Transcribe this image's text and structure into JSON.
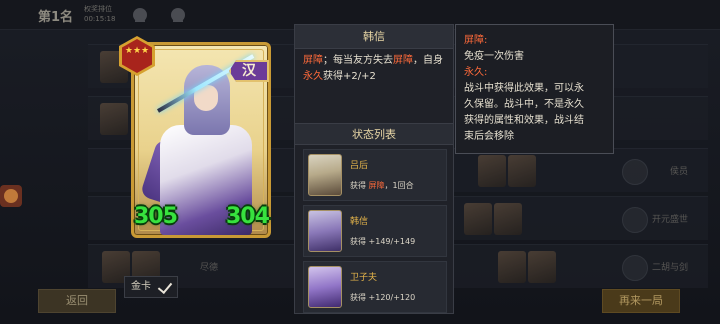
{
  "background": {
    "rank_title": "第1名",
    "timer_label": "权奖排位",
    "timer_value": "00:15:18",
    "row_labels": [
      "侯员",
      "开元盛世",
      "二胡与剑"
    ],
    "bottom_row_label": "尽德",
    "back_button": "返回",
    "again_button": "再来一局"
  },
  "hero_card": {
    "faction": "汉",
    "stars": "★★★",
    "attack": "305",
    "health": "304",
    "card_type_label": "金卡"
  },
  "detail": {
    "name": "韩信",
    "desc": {
      "k1": "屏障",
      "t1": "；每当友方失去",
      "k2": "屏障",
      "t2": "，自身",
      "k3": "永久",
      "t3": "获得+2/+2"
    },
    "status_list_title": "状态列表",
    "status_list": [
      {
        "name": "吕后",
        "effect_prefix": "获得 ",
        "effect_keyword": "屏障",
        "effect_suffix": "，1回合"
      },
      {
        "name": "韩信",
        "effect_prefix": "获得 +149/+149",
        "effect_keyword": "",
        "effect_suffix": ""
      },
      {
        "name": "卫子夫",
        "effect_prefix": "获得 +120/+120",
        "effect_keyword": "",
        "effect_suffix": ""
      }
    ]
  },
  "tooltip": {
    "barrier_key": "屏障:",
    "barrier_text": "免疫一次伤害",
    "permanent_key": "永久:",
    "permanent_line1": "战斗中获得此效果，可以永",
    "permanent_line2": "久保留。战斗中，不是永久",
    "permanent_line3": "获得的属性和效果，战斗结",
    "permanent_line4": "束后会移除"
  },
  "colors": {
    "card_border": "#c99a35",
    "stat_green": "#37e23e",
    "keyword_red": "#ff6a3a",
    "keyword_gold": "#e4b44a",
    "faction_purple": "#6b3b98"
  }
}
